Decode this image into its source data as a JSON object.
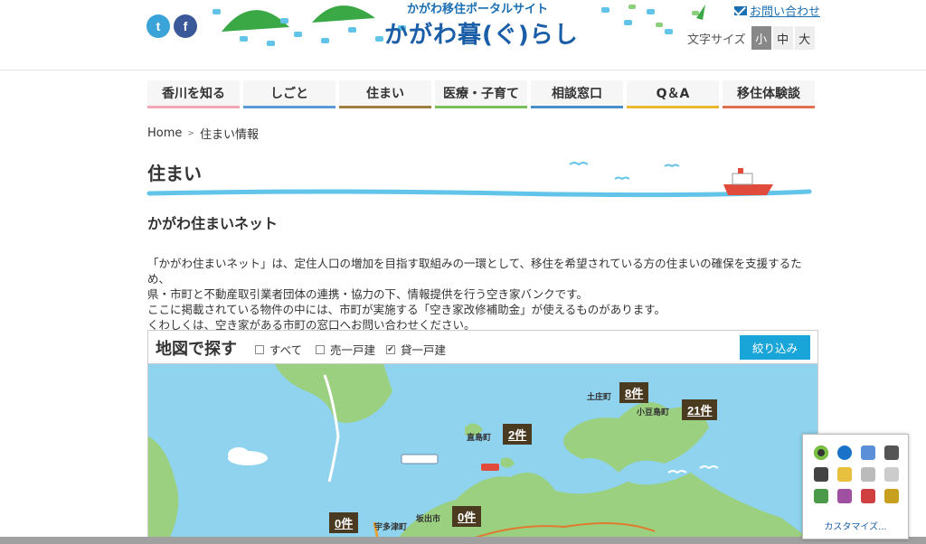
{
  "header": {
    "logo_sub": "かがわ移住ポータルサイト",
    "logo_main": "かがわ暮(ぐ)らし",
    "social": [
      "t",
      "f"
    ],
    "contact_label": "お問い合わせ",
    "font_size_label": "文字サイズ",
    "font_sizes": [
      "小",
      "中",
      "大"
    ],
    "font_size_selected": "小"
  },
  "nav": [
    {
      "label": "香川を知る",
      "color": "#f2a7b8"
    },
    {
      "label": "しごと",
      "color": "#5a9bd6"
    },
    {
      "label": "住まい",
      "color": "#a08040"
    },
    {
      "label": "医療・子育て",
      "color": "#7bbf5a"
    },
    {
      "label": "相談窓口",
      "color": "#4a8fc8"
    },
    {
      "label": "Q＆A",
      "color": "#e8b830"
    },
    {
      "label": "移住体験談",
      "color": "#e07050"
    }
  ],
  "breadcrumb": {
    "home": "Home",
    "current": "住まい情報"
  },
  "page_title": "住まい",
  "section_title": "かがわ住まいネット",
  "intro": [
    "「かがわ住まいネット」は、定住人口の増加を目指す取組みの一環として、移住を希望されている方の住まいの確保を支援するため、",
    "県・市町と不動産取引業者団体の連携・協力の下、情報提供を行う空き家バンクです。",
    "ここに掲載されている物件の中には、市町が実施する「空き家改修補助金」が使えるものがあります。",
    "くわしくは、空き家がある市町の窓口へお問い合わせください。"
  ],
  "map_search": {
    "title": "地図で探す",
    "options": [
      {
        "label": "すべて",
        "checked": false
      },
      {
        "label": "売一戸建",
        "checked": false
      },
      {
        "label": "貸一戸建",
        "checked": true
      }
    ],
    "filter_button": "絞り込み",
    "markers": [
      {
        "town": "土庄町",
        "count": "8件"
      },
      {
        "town": "小豆島町",
        "count": "21件"
      },
      {
        "town": "直島町",
        "count": "2件"
      },
      {
        "town": "宇多津町",
        "count": "0件"
      },
      {
        "town": "坂出市",
        "count": "0件"
      }
    ]
  },
  "tray": {
    "customize_label": "カスタマイズ...",
    "icons": [
      "nvidia-icon",
      "bluetooth-icon",
      "network-user-icon",
      "video-icon",
      "video-icon-2",
      "warning-icon",
      "signal-icon",
      "volume-icon",
      "app-icon-1",
      "app-icon-2",
      "flag-icon",
      "shield-icon"
    ]
  }
}
